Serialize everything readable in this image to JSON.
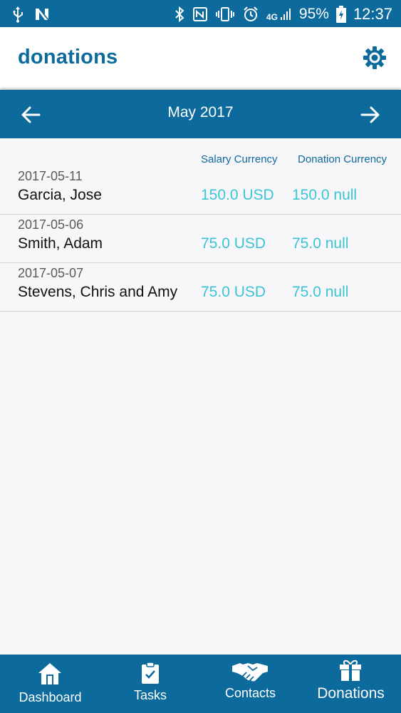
{
  "status_bar": {
    "left_icons": [
      "usb-icon",
      "n-notification-icon"
    ],
    "right_icons": [
      "bluetooth-icon",
      "nfc-icon",
      "vibrate-icon",
      "alarm-icon",
      "4g-signal-icon",
      "battery-charging-icon"
    ],
    "network": "4G",
    "battery": "95%",
    "time": "12:37"
  },
  "app_bar": {
    "title": "donations",
    "settings_icon": "gear-icon"
  },
  "month_nav": {
    "month": "May 2017",
    "prev_icon": "arrow-left-icon",
    "next_icon": "arrow-right-icon"
  },
  "columns": {
    "salary": "Salary Currency",
    "donation": "Donation Currency"
  },
  "rows": [
    {
      "date": "2017-05-11",
      "name": "Garcia, Jose",
      "salary": "150.0 USD",
      "donation": "150.0 null"
    },
    {
      "date": "2017-05-06",
      "name": "Smith, Adam",
      "salary": "75.0 USD",
      "donation": "75.0 null"
    },
    {
      "date": "2017-05-07",
      "name": "Stevens, Chris and Amy",
      "salary": "75.0 USD",
      "donation": "75.0 null"
    }
  ],
  "bottom_nav": [
    {
      "label": "Dashboard",
      "icon": "house-icon"
    },
    {
      "label": "Tasks",
      "icon": "clipboard-check-icon"
    },
    {
      "label": "Contacts",
      "icon": "handshake-icon"
    },
    {
      "label": "Donations",
      "icon": "gift-icon",
      "active": true
    }
  ],
  "colors": {
    "primary": "#0c6a9d",
    "amount": "#3cc4d6",
    "background": "#f7f6f8"
  }
}
